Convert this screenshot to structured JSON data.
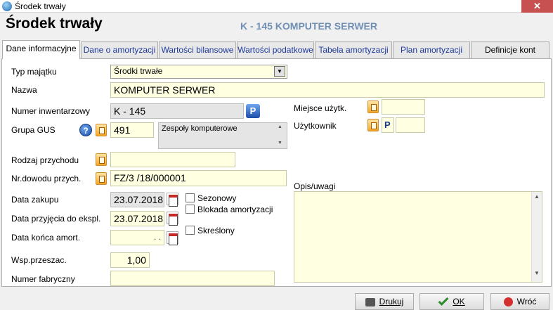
{
  "window": {
    "title": "Środek trwały",
    "close_glyph": "✕"
  },
  "header": {
    "title": "Środek trwały",
    "subtitle": "K - 145 KOMPUTER SERWER"
  },
  "tabs": [
    {
      "label": "Dane informacyjne"
    },
    {
      "label": "Dane o amortyzacji"
    },
    {
      "label": "Wartości bilansowe"
    },
    {
      "label": "Wartości podatkowe"
    },
    {
      "label": "Tabela amortyzacji"
    },
    {
      "label": "Plan amortyzacji"
    },
    {
      "label": "Definicje kont"
    }
  ],
  "form": {
    "typ_label": "Typ majątku",
    "typ_value": "Środki trwałe",
    "nazwa_label": "Nazwa",
    "nazwa_value": "KOMPUTER SERWER",
    "numer_label": "Numer inwentarzowy",
    "numer_value": "K - 145",
    "gus_label": "Grupa GUS",
    "gus_value": "491",
    "gus_desc": "Zespoły komputerowe",
    "rodzaj_label": "Rodzaj przychodu",
    "rodzaj_value": "",
    "dowod_label": "Nr.dowodu przych.",
    "dowod_value": "FZ/3  /18/000001",
    "zakup_label": "Data zakupu",
    "zakup_value": "23.07.2018",
    "przyjecie_label": "Data przyjęcia do ekspl.",
    "przyjecie_value": "23.07.2018",
    "koniec_label": "Data końca amort.",
    "koniec_value": ". .",
    "wsp_label": "Wsp.przeszac.",
    "wsp_value": "1,00",
    "fabryczny_label": "Numer fabryczny",
    "fabryczny_value": "",
    "sezonowy_label": "Sezonowy",
    "blokada_label": "Blokada amortyzacji",
    "skreslony_label": "Skreślony",
    "miejsce_label": "Miejsce użytk.",
    "miejsce_value": "",
    "uzytkownik_label": "Użytkownik",
    "uzytkownik_value": "P",
    "opis_label": "Opis/uwagi",
    "opis_value": ""
  },
  "buttons": {
    "print": "Drukuj",
    "ok": "OK",
    "back": "Wróć"
  },
  "icons": {
    "gus_help": "?",
    "dropdown": "▼",
    "scroll_up": "▲",
    "scroll_down": "▼",
    "numer_btn": "P"
  },
  "colors": {
    "field_bg": "#ffffe1",
    "subtitle": "#6f8fb5",
    "close": "#c75050"
  }
}
